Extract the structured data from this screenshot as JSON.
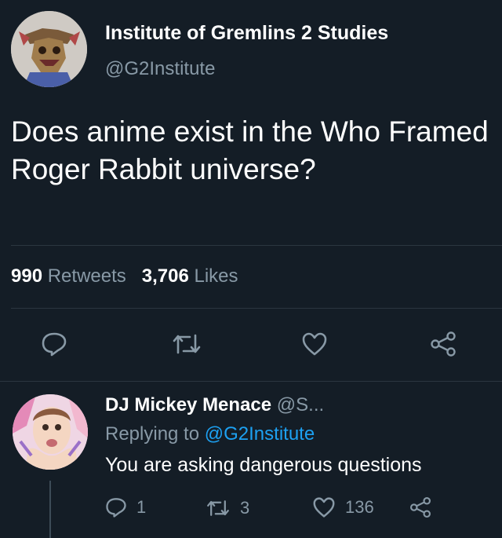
{
  "tweet": {
    "author_name": "Institute of Gremlins 2 Studies",
    "author_handle": "@G2Institute",
    "text": "Does anime exist in the Who Framed Roger Rabbit universe?",
    "retweet_count": "990",
    "retweet_label": "Retweets",
    "like_count": "3,706",
    "like_label": "Likes"
  },
  "actions": {
    "reply_icon": "reply-icon",
    "retweet_icon": "retweet-icon",
    "like_icon": "heart-icon",
    "share_icon": "share-icon"
  },
  "reply": {
    "author_name": "DJ Mickey Menace",
    "author_handle": "@S...",
    "replying_prefix": "Replying to",
    "replying_handle": "@G2Institute",
    "text": "You are asking dangerous questions",
    "reply_count": "1",
    "retweet_count": "3",
    "like_count": "136"
  },
  "colors": {
    "background": "#141d26",
    "secondary_text": "#8899a6",
    "link": "#1da1f2",
    "divider": "#2b3640"
  }
}
